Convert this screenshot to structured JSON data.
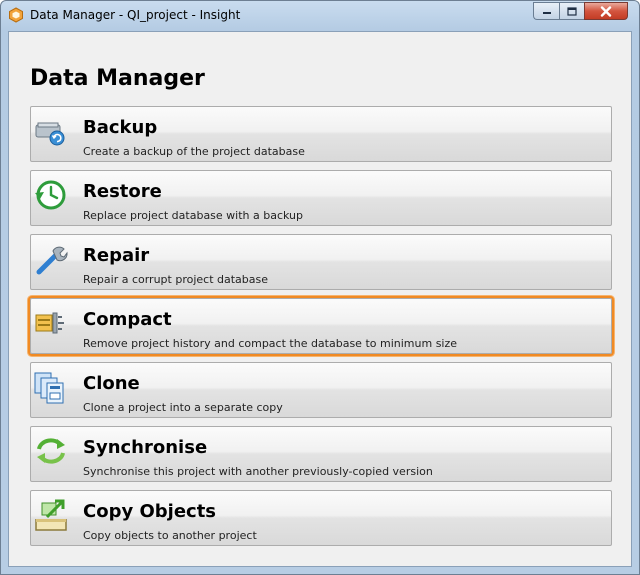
{
  "window": {
    "title": "Data Manager - QI_project - Insight",
    "controls": {
      "minimize_icon": "minimize-icon",
      "maximize_icon": "maximize-icon",
      "close_icon": "close-icon"
    }
  },
  "main": {
    "heading": "Data Manager",
    "items": [
      {
        "label": "Backup",
        "description": "Create a backup of the project database",
        "icon": "backup-icon"
      },
      {
        "label": "Restore",
        "description": "Replace project database with a backup",
        "icon": "restore-icon"
      },
      {
        "label": "Repair",
        "description": "Repair a corrupt project database",
        "icon": "repair-icon"
      },
      {
        "label": "Compact",
        "description": "Remove project history and compact the database to minimum size",
        "icon": "compact-icon",
        "selected": true
      },
      {
        "label": "Clone",
        "description": "Clone a project into a separate copy",
        "icon": "clone-icon"
      },
      {
        "label": "Synchronise",
        "description": "Synchronise this project with another previously-copied version",
        "icon": "synchronise-icon"
      },
      {
        "label": "Copy Objects",
        "description": "Copy objects to another project",
        "icon": "copy-objects-icon"
      }
    ]
  },
  "colors": {
    "selection_border": "#f08a24",
    "close_button": "#c9462f",
    "title_bar": "#b9cfe6"
  }
}
